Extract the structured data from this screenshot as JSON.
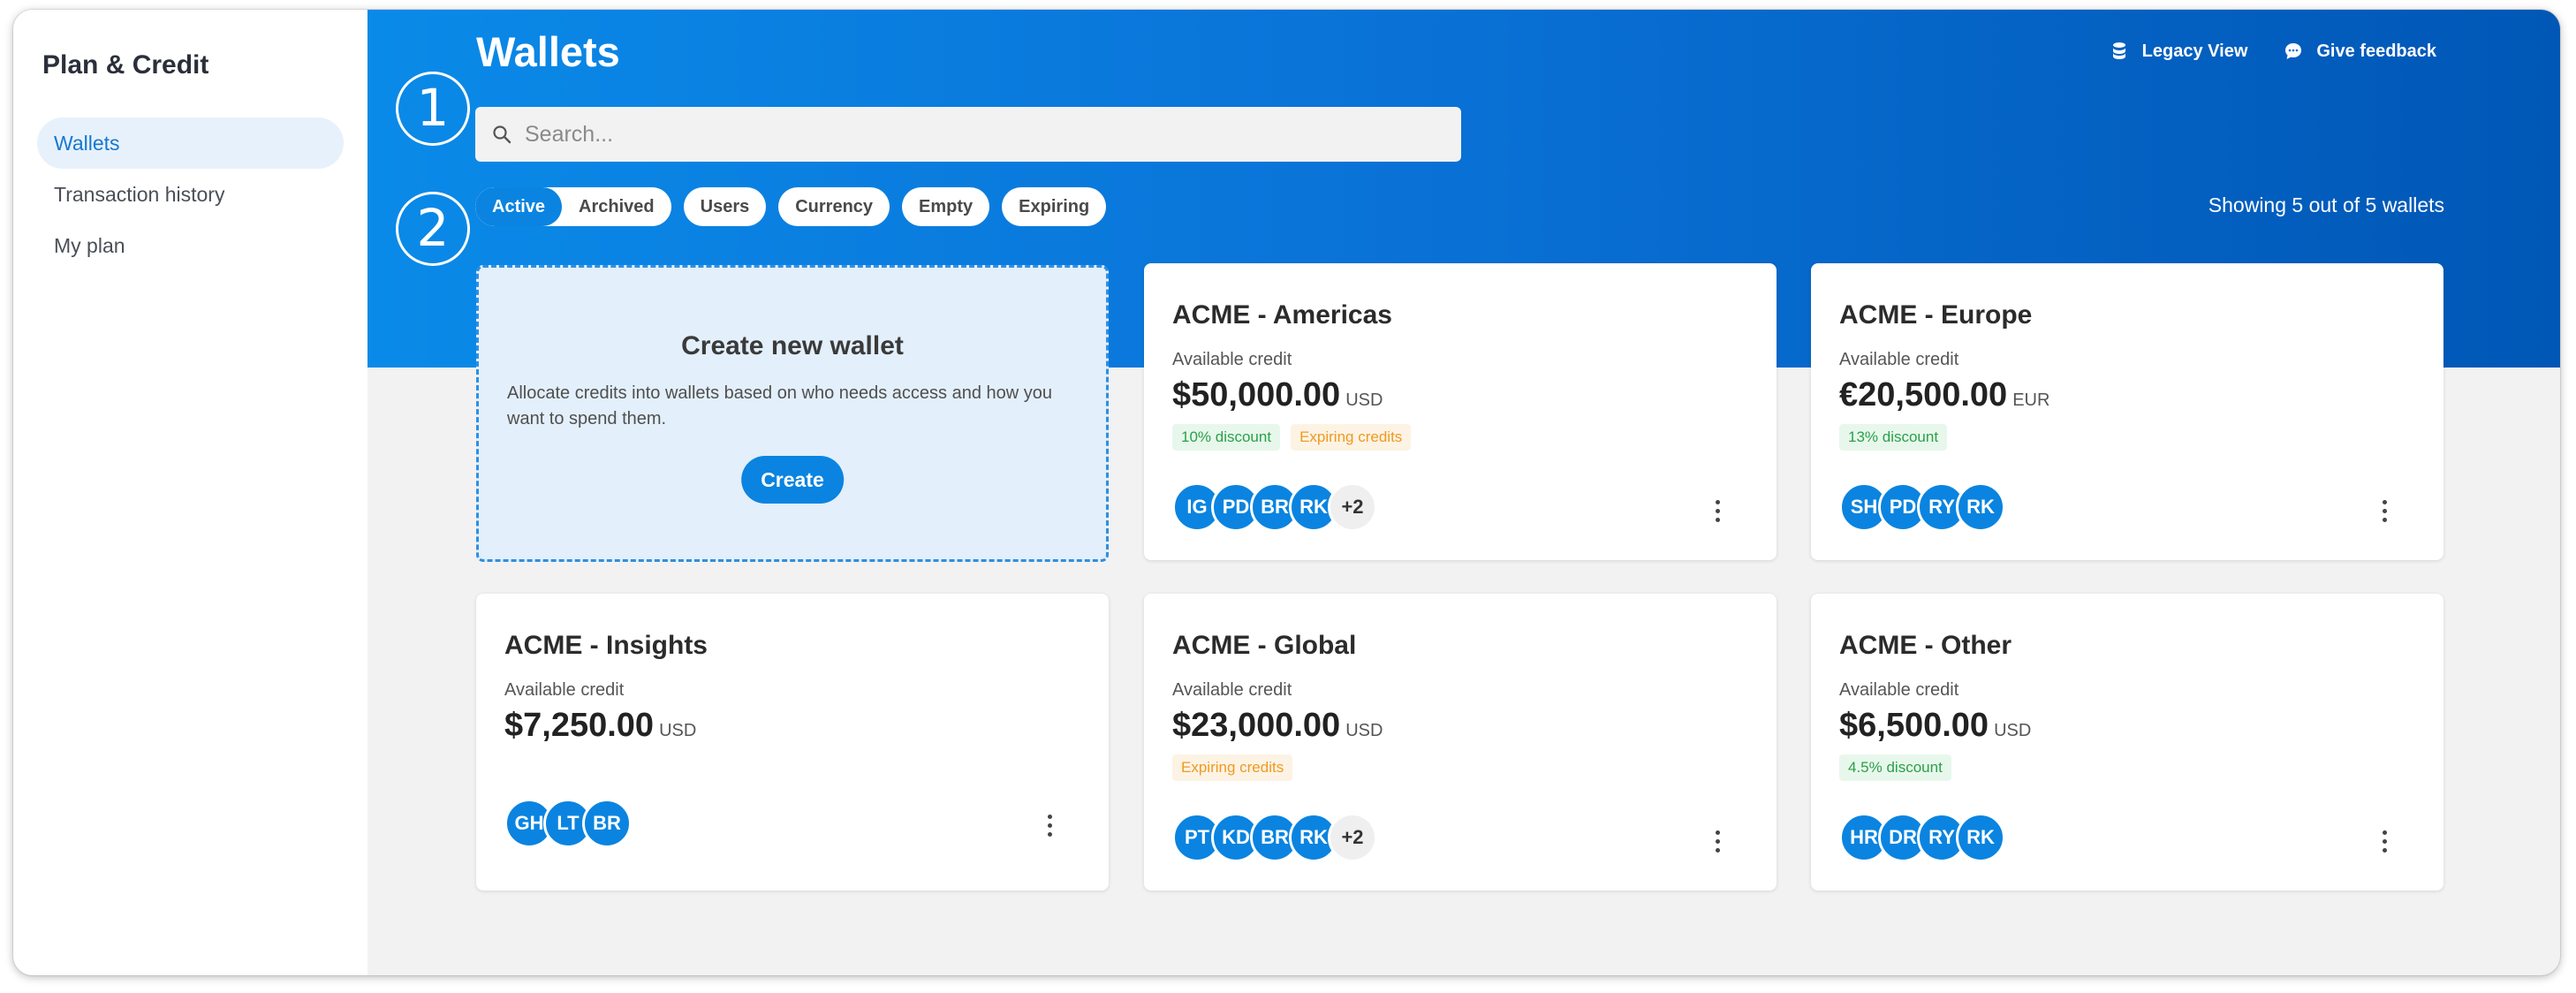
{
  "sidebar": {
    "title": "Plan & Credit",
    "items": [
      {
        "label": "Wallets"
      },
      {
        "label": "Transaction history"
      },
      {
        "label": "My plan"
      }
    ]
  },
  "header": {
    "title": "Wallets",
    "legacy_view": "Legacy View",
    "feedback": "Give feedback",
    "step1": "1",
    "step2": "2"
  },
  "search": {
    "placeholder": "Search..."
  },
  "filters": {
    "status_options": [
      "Active",
      "Archived"
    ],
    "selected_status": "Active",
    "chips": [
      "Users",
      "Currency",
      "Empty",
      "Expiring"
    ]
  },
  "showing_text": "Showing 5 out of 5 wallets",
  "create_card": {
    "title": "Create new wallet",
    "description": "Allocate credits into wallets based on who needs access and how you want to spend them.",
    "button": "Create"
  },
  "wallets": [
    {
      "name": "ACME - Americas",
      "label": "Available credit",
      "amount": "$50,000.00",
      "currency": "USD",
      "badges": [
        {
          "text": "10% discount",
          "kind": "green"
        },
        {
          "text": "Expiring credits",
          "kind": "orange"
        }
      ],
      "users": [
        "IG",
        "PD",
        "BR",
        "RK"
      ],
      "more": "+2"
    },
    {
      "name": "ACME - Europe",
      "label": "Available credit",
      "amount": "€20,500.00",
      "currency": "EUR",
      "badges": [
        {
          "text": "13% discount",
          "kind": "green"
        }
      ],
      "users": [
        "SH",
        "PD",
        "RY",
        "RK"
      ],
      "more": ""
    },
    {
      "name": "ACME - Insights",
      "label": "Available credit",
      "amount": "$7,250.00",
      "currency": "USD",
      "badges": [],
      "users": [
        "GH",
        "LT",
        "BR"
      ],
      "more": ""
    },
    {
      "name": "ACME - Global",
      "label": "Available credit",
      "amount": "$23,000.00",
      "currency": "USD",
      "badges": [
        {
          "text": "Expiring credits",
          "kind": "orange"
        }
      ],
      "users": [
        "PT",
        "KD",
        "BR",
        "RK"
      ],
      "more": "+2"
    },
    {
      "name": "ACME - Other",
      "label": "Available credit",
      "amount": "$6,500.00",
      "currency": "USD",
      "badges": [
        {
          "text": "4.5% discount",
          "kind": "green"
        }
      ],
      "users": [
        "HR",
        "DR",
        "RY",
        "RK"
      ],
      "more": ""
    }
  ],
  "colors": {
    "accent": "#0a84e0",
    "hero_start": "#0a8ae8",
    "hero_end": "#0057b6"
  }
}
